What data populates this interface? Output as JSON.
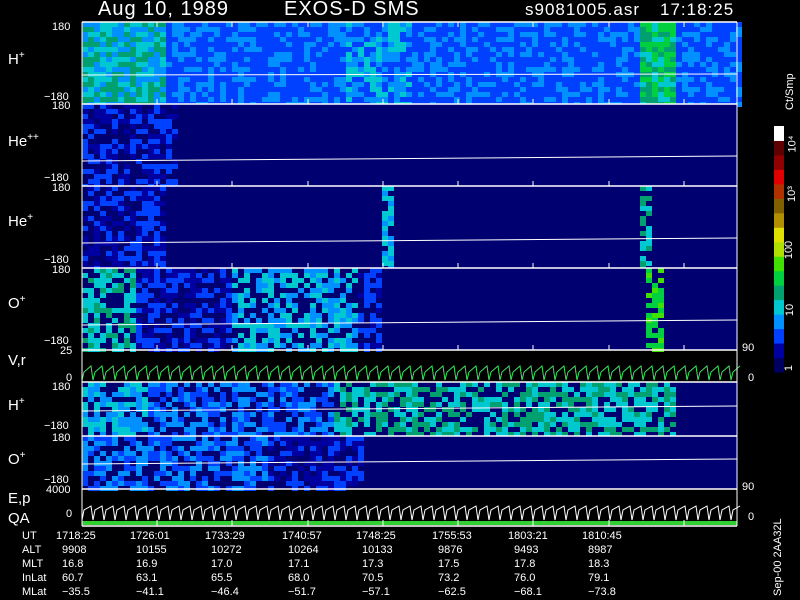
{
  "header": {
    "date_label": "Aug 10, 1989",
    "instrument_label": "EXOS-D SMS",
    "file_label": "s9081005.asr",
    "time_label": "17:18:25"
  },
  "colorbar": {
    "unit_label": "Ct/Smp",
    "tick_labels": [
      "1",
      "10",
      "100",
      "10³",
      "10⁴"
    ],
    "colors": [
      "#000060",
      "#0000a0",
      "#0040ff",
      "#0090ff",
      "#00c8d0",
      "#00a070",
      "#00d040",
      "#40e000",
      "#b0e000",
      "#e0e000",
      "#b09000",
      "#806000",
      "#b03000",
      "#e00000",
      "#900000",
      "#600000",
      "#ffffff"
    ]
  },
  "panels": [
    {
      "label": "H",
      "charge": "+",
      "top_tick": "180",
      "bottom_tick": "−180"
    },
    {
      "label": "He",
      "charge": "++",
      "top_tick": "180",
      "bottom_tick": "−180"
    },
    {
      "label": "He",
      "charge": "+",
      "top_tick": "180",
      "bottom_tick": "−180"
    },
    {
      "label": "O",
      "charge": "+",
      "top_tick": "180",
      "bottom_tick": "−180"
    },
    {
      "label": "V,r",
      "charge": "",
      "top_tick": "25",
      "bottom_tick": "0",
      "right_top_tick": "90",
      "right_bottom_tick": "0"
    },
    {
      "label": "H",
      "charge": "+",
      "top_tick": "180",
      "bottom_tick": "−180"
    },
    {
      "label": "O",
      "charge": "+",
      "top_tick": "180",
      "bottom_tick": "−180"
    },
    {
      "label": "E,p",
      "charge": "",
      "top_tick": "4000",
      "bottom_tick": "0",
      "right_top_tick": "90",
      "right_bottom_tick": "0"
    },
    {
      "label": "QA",
      "charge": "",
      "top_tick": "",
      "bottom_tick": ""
    }
  ],
  "orbit_table": {
    "row_labels": [
      "UT",
      "ALT",
      "MLT",
      "InLat",
      "MLat"
    ],
    "columns": [
      [
        "1718:25",
        "9908",
        "16.8",
        "60.7",
        "−35.5"
      ],
      [
        "1726:01",
        "10155",
        "16.9",
        "63.1",
        "−41.1"
      ],
      [
        "1733:29",
        "10272",
        "17.0",
        "65.5",
        "−46.4"
      ],
      [
        "1740:57",
        "10264",
        "17.1",
        "68.0",
        "−51.7"
      ],
      [
        "1748:25",
        "10133",
        "17.3",
        "70.5",
        "−57.1"
      ],
      [
        "1755:53",
        "9876",
        "17.5",
        "73.2",
        "−62.5"
      ],
      [
        "1803:21",
        "9493",
        "17.8",
        "76.0",
        "−68.1"
      ],
      [
        "1810:45",
        "8987",
        "18.3",
        "79.1",
        "−73.8"
      ]
    ]
  },
  "footer": {
    "version_label": "Sep-00 2AA32L"
  },
  "chart_data": {
    "type": "heatmap",
    "title": "Aug 10, 1989   EXOS-D SMS",
    "x_tick_labels": [
      "1718:25",
      "1726:01",
      "1733:29",
      "1740:57",
      "1748:25",
      "1755:53",
      "1803:21",
      "1810:45"
    ],
    "y_range": [
      -180,
      180
    ],
    "color_scale": "log",
    "color_range": [
      1,
      10000
    ],
    "series": [
      {
        "name": "H+",
        "activity": [
          [
            0.0,
            0.12,
            4
          ],
          [
            0.12,
            0.4,
            2
          ],
          [
            0.4,
            0.5,
            3
          ],
          [
            0.5,
            0.6,
            2
          ],
          [
            0.6,
            0.85,
            2
          ],
          [
            0.85,
            0.9,
            5
          ],
          [
            0.9,
            1.0,
            2
          ]
        ]
      },
      {
        "name": "He++",
        "activity": [
          [
            0.0,
            0.14,
            1
          ],
          [
            0.14,
            1.0,
            0
          ]
        ]
      },
      {
        "name": "He+",
        "activity": [
          [
            0.0,
            0.12,
            1
          ],
          [
            0.45,
            0.47,
            3
          ],
          [
            0.85,
            0.87,
            4
          ]
        ]
      },
      {
        "name": "O+",
        "activity": [
          [
            0.0,
            0.08,
            4
          ],
          [
            0.08,
            0.22,
            1
          ],
          [
            0.22,
            0.42,
            3
          ],
          [
            0.42,
            0.45,
            1
          ],
          [
            0.86,
            0.88,
            6
          ]
        ]
      },
      {
        "name": "H+ (lower)",
        "activity": [
          [
            0.0,
            0.1,
            3
          ],
          [
            0.1,
            0.38,
            2
          ],
          [
            0.38,
            0.9,
            4
          ]
        ]
      },
      {
        "name": "O+ (lower)",
        "activity": [
          [
            0.0,
            0.28,
            2
          ],
          [
            0.28,
            0.43,
            1
          ],
          [
            0.43,
            0.65,
            0
          ]
        ]
      }
    ]
  }
}
